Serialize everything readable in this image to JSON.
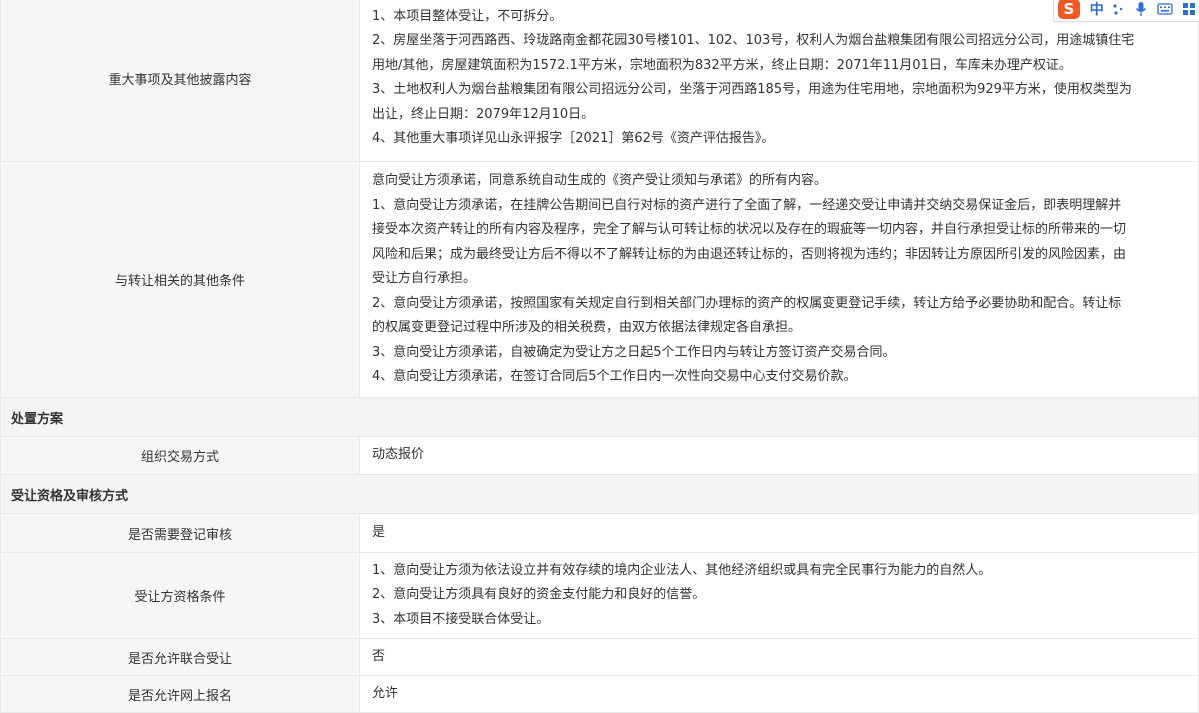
{
  "rows": {
    "major_matters": {
      "label": "重大事项及其他披露内容",
      "lines": [
        "1、本项目整体受让，不可拆分。",
        "2、房屋坐落于河西路西、玲珑路南金都花园30号楼101、102、103号，权利人为烟台盐粮集团有限公司招远分公司，用途城镇住宅",
        "用地/其他，房屋建筑面积为1572.1平方米，宗地面积为832平方米，终止日期：2071年11月01日，车库未办理产权证。",
        "3、土地权利人为烟台盐粮集团有限公司招远分公司，坐落于河西路185号，用途为住宅用地，宗地面积为929平方米，使用权类型为",
        "出让，终止日期：2079年12月10日。",
        "4、其他重大事项详见山永评报字［2021］第62号《资产评估报告》。"
      ]
    },
    "other_conditions": {
      "label": "与转让相关的其他条件",
      "lines": [
        "意向受让方须承诺，同意系统自动生成的《资产受让须知与承诺》的所有内容。",
        "1、意向受让方须承诺，在挂牌公告期间已自行对标的资产进行了全面了解，一经递交受让申请并交纳交易保证金后，即表明理解并",
        "接受本次资产转让的所有内容及程序，完全了解与认可转让标的状况以及存在的瑕疵等一切内容，并自行承担受让标的所带来的一切",
        "风险和后果；成为最终受让方后不得以不了解转让标的为由退还转让标的，否则将视为违约；非因转让方原因所引发的风险因素，由",
        "受让方自行承担。",
        "2、意向受让方须承诺，按照国家有关规定自行到相关部门办理标的资产的权属变更登记手续，转让方给予必要协助和配合。转让标",
        "的权属变更登记过程中所涉及的相关税费，由双方依据法律规定各自承担。",
        "3、意向受让方须承诺，自被确定为受让方之日起5个工作日内与转让方签订资产交易合同。",
        "4、意向受让方须承诺，在签订合同后5个工作日内一次性向交易中心支付交易价款。"
      ]
    },
    "disposal_section": "处置方案",
    "trade_method": {
      "label": "组织交易方式",
      "value": "动态报价"
    },
    "qualification_section": "受让资格及审核方式",
    "need_registration": {
      "label": "是否需要登记审核",
      "value": "是"
    },
    "qualification": {
      "label": "受让方资格条件",
      "lines": [
        "1、意向受让方须为依法设立并有效存续的境内企业法人、其他经济组织或具有完全民事行为能力的自然人。",
        "2、意向受让方须具有良好的资金支付能力和良好的信誉。",
        "3、本项目不接受联合体受让。"
      ]
    },
    "joint_bid": {
      "label": "是否允许联合受让",
      "value": "否"
    },
    "online_signup": {
      "label": "是否允许网上报名",
      "value": "允许"
    }
  },
  "ime_toolbar": {
    "logo": "S",
    "lang": "中",
    "icons": [
      "punctuation-icon",
      "microphone-icon",
      "keyboard-icon",
      "grid-menu-icon"
    ]
  }
}
